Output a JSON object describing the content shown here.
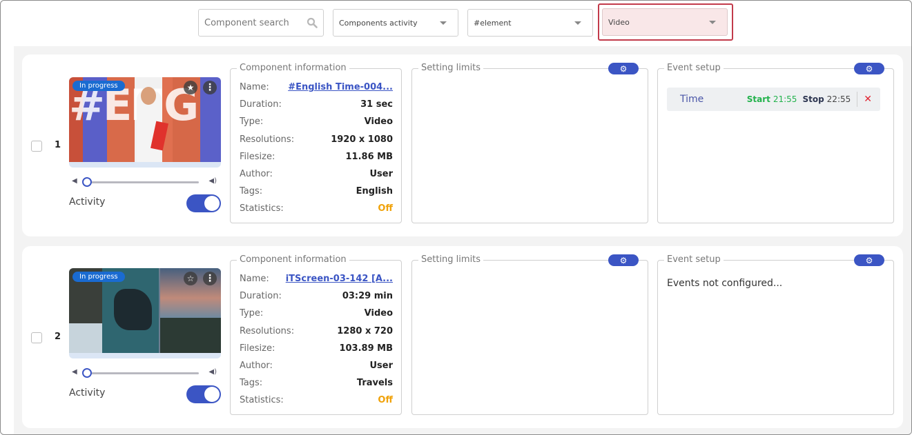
{
  "toolbar": {
    "search_placeholder": "Component search",
    "search_icon": "search-icon",
    "filter_activity": "Components activity",
    "filter_element": "#element",
    "filter_type": "Video"
  },
  "labels": {
    "name": "Name:",
    "duration": "Duration:",
    "type": "Type:",
    "resolutions": "Resolutions:",
    "filesize": "Filesize:",
    "author": "Author:",
    "tags": "Tags:",
    "statistics": "Statistics:",
    "component_information": "Component information",
    "setting_limits": "Setting limits",
    "event_setup": "Event setup",
    "activity": "Activity",
    "gear_icon": "⚙",
    "star_filled": "★",
    "star_outline": "☆",
    "more": "⋮",
    "volume_low": "🔈",
    "volume_high": "🔊"
  },
  "items": [
    {
      "index": "1",
      "status": "In progress",
      "favorite": true,
      "volume": 0,
      "activity_on": true,
      "name": "#English Time-004...",
      "duration": "31 sec",
      "type": "Video",
      "resolution": "1920 x 1080",
      "filesize": "11.86 MB",
      "author": "User",
      "tags": "English",
      "statistics": "Off",
      "events": [
        {
          "name": "Time",
          "start_label": "Start",
          "start": "21:55",
          "stop_label": "Stop",
          "stop": "22:55",
          "delete_icon": "✕"
        }
      ],
      "events_empty_text": ""
    },
    {
      "index": "2",
      "status": "In progress",
      "favorite": false,
      "volume": 0,
      "activity_on": true,
      "name": "iTScreen-03-142 [A...",
      "duration": "03:29 min",
      "type": "Video",
      "resolution": "1280 x 720",
      "filesize": "103.89 MB",
      "author": "User",
      "tags": "Travels",
      "statistics": "Off",
      "events": [],
      "events_empty_text": "Events not configured..."
    }
  ]
}
